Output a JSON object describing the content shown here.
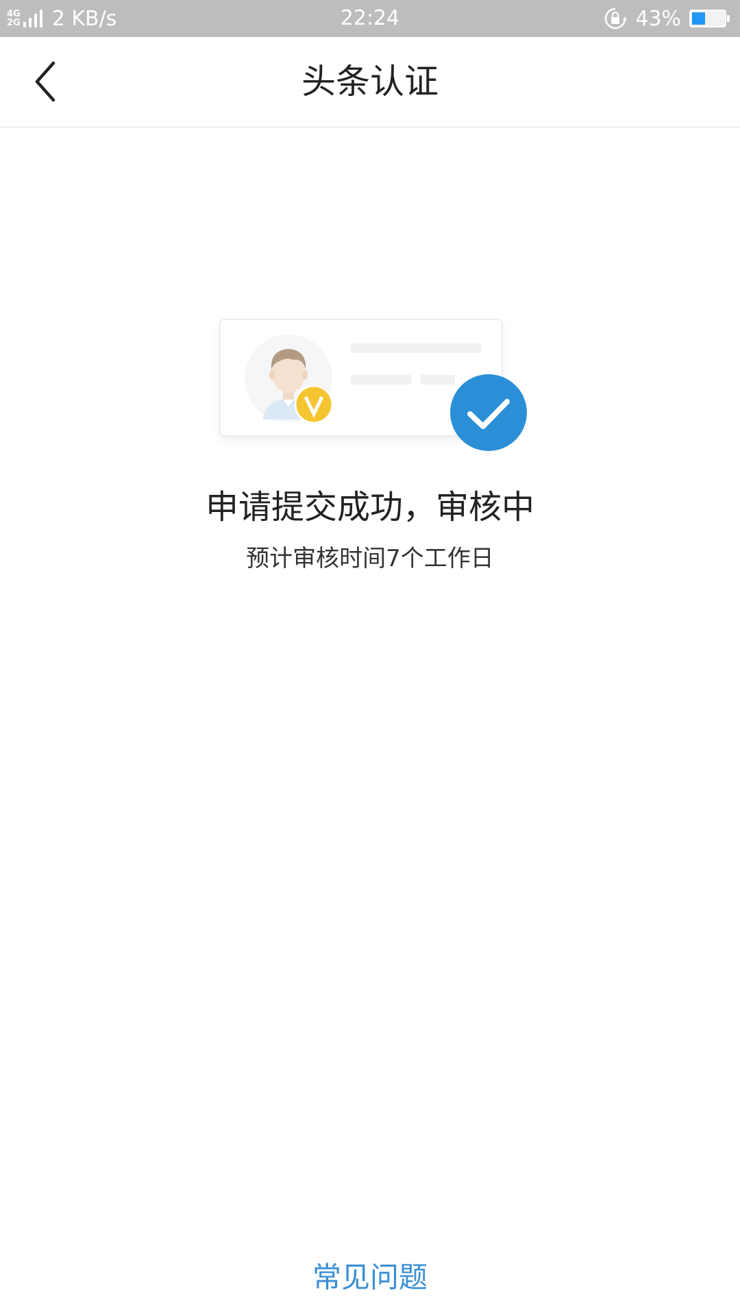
{
  "status_bar": {
    "network_top": "4G",
    "network_bottom": "2G",
    "speed": "2 KB/s",
    "time": "22:24",
    "battery_percent_text": "43%",
    "battery_level": 0.43,
    "icons": [
      "signal-icon",
      "rotation-lock-icon",
      "battery-icon"
    ]
  },
  "header": {
    "title": "头条认证",
    "back_icon": "chevron-left-icon"
  },
  "illustration": {
    "badge_letter": "V",
    "accent": "#2b8fd8",
    "badge_color": "#f5c531"
  },
  "result": {
    "title": "申请提交成功，审核中",
    "subtitle": "预计审核时间7个工作日"
  },
  "footer": {
    "faq_label": "常见问题",
    "link_color": "#3b8fd6"
  }
}
